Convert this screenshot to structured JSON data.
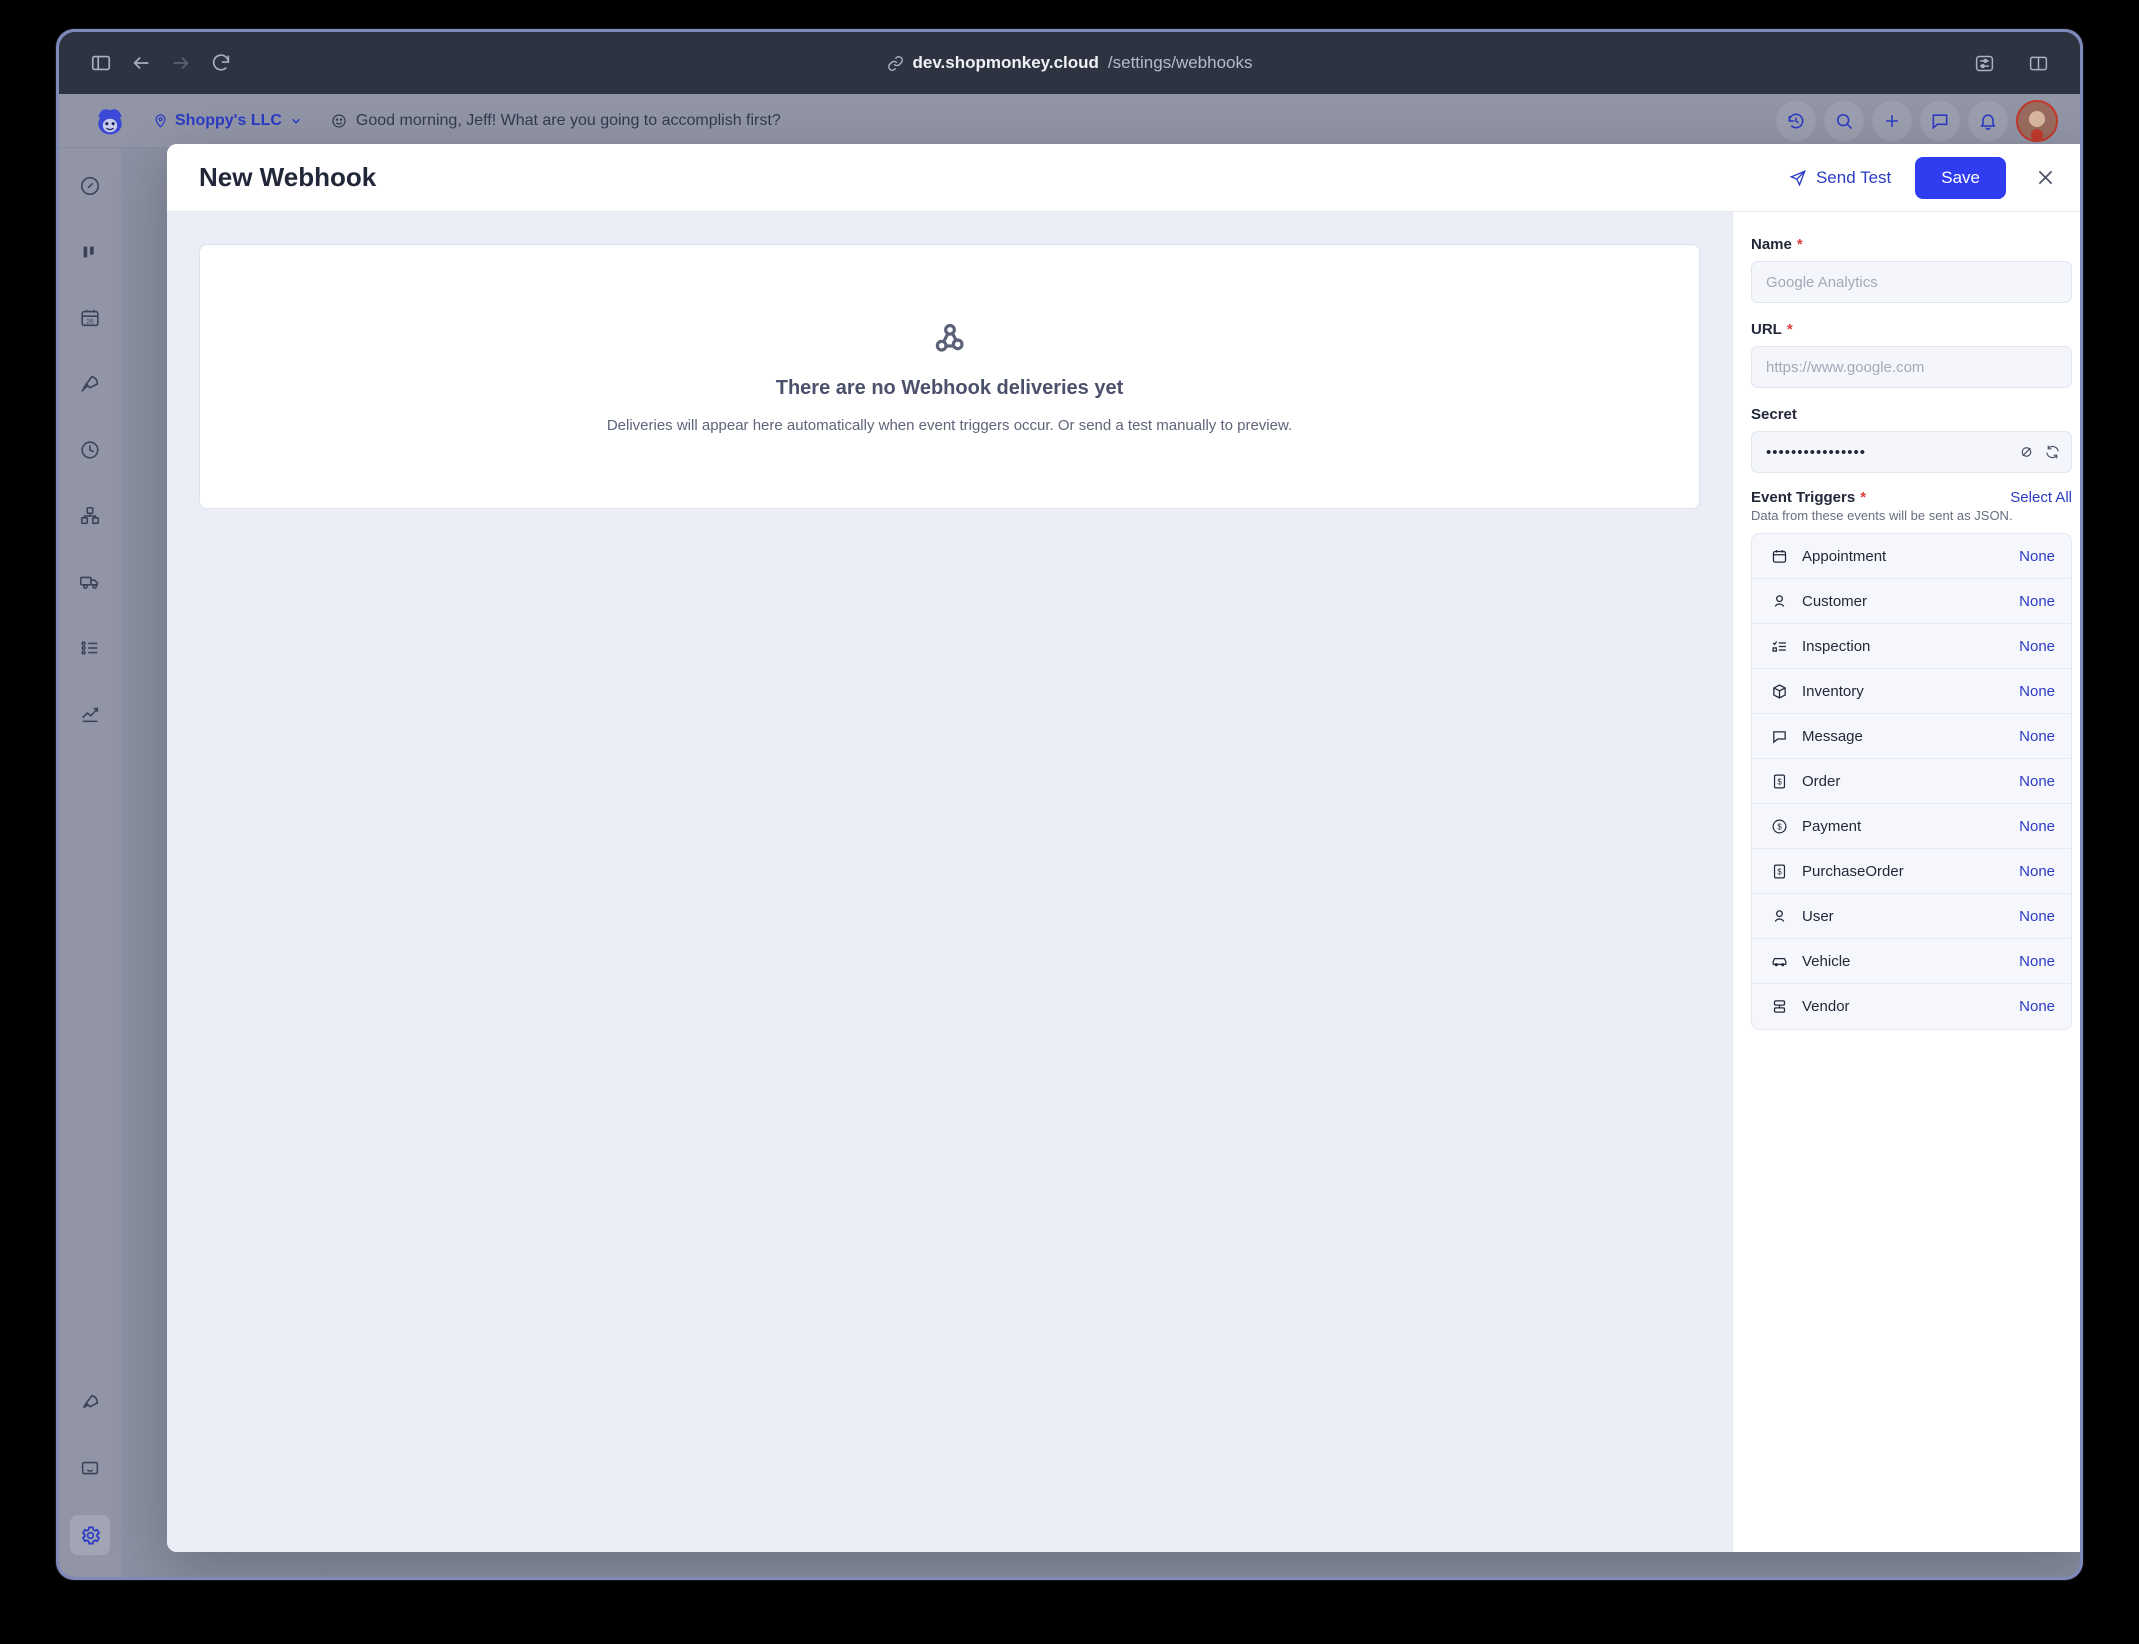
{
  "browser": {
    "sidebar_toggle": "sidebar-toggle",
    "back": "back",
    "forward": "forward",
    "reload": "reload",
    "url_domain": "dev.shopmonkey.cloud",
    "url_path": "/settings/webhooks",
    "right_icons": [
      "extensions-icon",
      "tab-overview-icon"
    ]
  },
  "app": {
    "shop_name": "Shoppy's LLC",
    "greeting": "Good morning, Jeff! What are you going to accomplish first?",
    "top_icons": [
      "history-icon",
      "search-icon",
      "plus-icon",
      "chat-icon",
      "bell-icon"
    ],
    "rail_icons": [
      "gauge-icon",
      "board-icon",
      "calendar-icon",
      "rocket-icon",
      "clock-icon",
      "workflow-icon",
      "truck-icon",
      "list-icon",
      "chart-icon"
    ],
    "rail_bottom_icons": [
      "rocket-outline-icon",
      "message-icon",
      "gear-icon"
    ]
  },
  "modal": {
    "title": "New Webhook",
    "send_test_label": "Send Test",
    "save_label": "Save",
    "close_label": "close-icon"
  },
  "deliveries": {
    "icon": "webhook-icon",
    "title": "There are no Webhook deliveries yet",
    "subtitle": "Deliveries will appear here automatically when event triggers occur. Or send a test manually to preview."
  },
  "form": {
    "name": {
      "label": "Name",
      "required": "*",
      "value": "",
      "placeholder": "Google Analytics"
    },
    "url": {
      "label": "URL",
      "required": "*",
      "value": "",
      "placeholder": "https://www.google.com"
    },
    "secret": {
      "label": "Secret",
      "value": "••••••••••••••••",
      "toggle_icon": "eye-off-icon",
      "regenerate_icon": "refresh-icon"
    },
    "triggers": {
      "label": "Event Triggers",
      "required": "*",
      "select_all": "Select All",
      "description": "Data from these events will be sent as JSON.",
      "rows": [
        {
          "icon": "calendar-icon",
          "label": "Appointment",
          "value": "None"
        },
        {
          "icon": "user-icon",
          "label": "Customer",
          "value": "None"
        },
        {
          "icon": "checklist-icon",
          "label": "Inspection",
          "value": "None"
        },
        {
          "icon": "box-icon",
          "label": "Inventory",
          "value": "None"
        },
        {
          "icon": "message-icon",
          "label": "Message",
          "value": "None"
        },
        {
          "icon": "invoice-icon",
          "label": "Order",
          "value": "None"
        },
        {
          "icon": "coin-icon",
          "label": "Payment",
          "value": "None"
        },
        {
          "icon": "invoice-icon",
          "label": "PurchaseOrder",
          "value": "None"
        },
        {
          "icon": "user-icon",
          "label": "User",
          "value": "None"
        },
        {
          "icon": "car-icon",
          "label": "Vehicle",
          "value": "None"
        },
        {
          "icon": "vendor-icon",
          "label": "Vendor",
          "value": "None"
        }
      ]
    }
  },
  "colors": {
    "accent": "#2b3bc4",
    "save_button": "#2f3cf0",
    "required": "#e23b3b",
    "panel_bg": "#eceef7"
  }
}
